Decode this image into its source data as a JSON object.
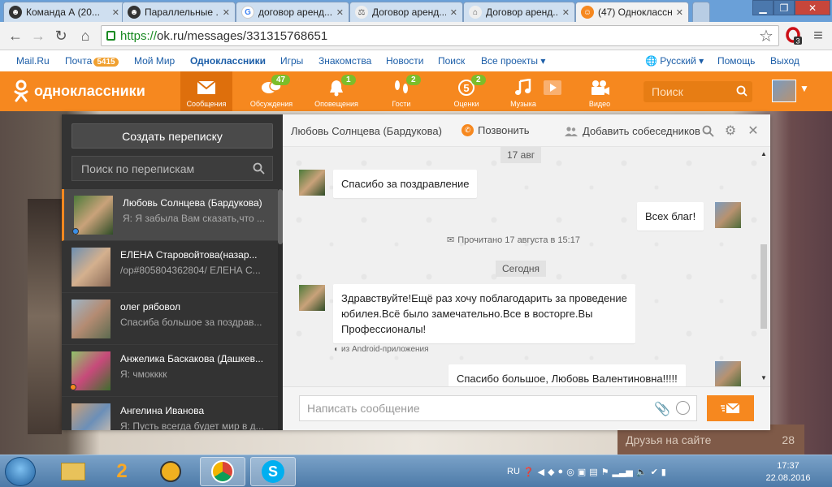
{
  "browser": {
    "tabs": [
      {
        "label": "Команда А (20...",
        "favicon": "face",
        "active": false
      },
      {
        "label": "Параллельные ...",
        "favicon": "face",
        "active": false
      },
      {
        "label": "договор аренд...",
        "favicon": "G",
        "active": false
      },
      {
        "label": "Договор аренд...",
        "favicon": "scales",
        "active": false
      },
      {
        "label": "Договор аренд...",
        "favicon": "house",
        "active": false
      },
      {
        "label": "(47) Одноклассн...",
        "favicon": "ok",
        "active": true
      }
    ],
    "url_scheme": "https://",
    "url_rest": "ok.ru/messages/331315768651",
    "opera_badge": "3"
  },
  "portal": {
    "links": [
      "Mail.Ru",
      "Почта",
      "Мой Мир",
      "Одноклассники",
      "Игры",
      "Знакомства",
      "Новости",
      "Поиск",
      "Все проекты ▾"
    ],
    "mail_count": "5415",
    "language": "Русский ▾",
    "help": "Помощь",
    "logout": "Выход"
  },
  "ok_header": {
    "logo_text": "одноклассники",
    "nav": [
      {
        "label": "Сообщения",
        "badge": "",
        "icon": "envelope-icon"
      },
      {
        "label": "Обсуждения",
        "badge": "47",
        "icon": "chat-bubbles-icon"
      },
      {
        "label": "Оповещения",
        "badge": "1",
        "icon": "bell-icon"
      },
      {
        "label": "Гости",
        "badge": "2",
        "icon": "footprints-icon"
      },
      {
        "label": "Оценки",
        "badge": "2",
        "icon": "rating-five-icon"
      },
      {
        "label": "Музыка",
        "badge": "",
        "icon": "music-note-icon"
      },
      {
        "label": "Видео",
        "badge": "",
        "icon": "video-camera-icon"
      }
    ],
    "search_placeholder": "Поиск"
  },
  "messenger": {
    "create_label": "Создать переписку",
    "search_placeholder": "Поиск по перепискам",
    "conversations": [
      {
        "name": "Любовь Солнцева (Бардукова)",
        "preview": "Я: Я забыла Вам сказать,что ...",
        "active": true,
        "status": "#3a8ee6"
      },
      {
        "name": "ЕЛЕНА Старовойтова(назар...",
        "preview": "/op#805804362804/ ЕЛЕНА С...",
        "active": false,
        "status": ""
      },
      {
        "name": "олег рябовол",
        "preview": "Спасиба большое за поздрав...",
        "active": false,
        "status": ""
      },
      {
        "name": "Анжелика Баскакова (Дашкев...",
        "preview": "Я: чмокккк",
        "active": false,
        "status": "#f6881f"
      },
      {
        "name": "Ангелина Иванова",
        "preview": "Я: Пусть всегда будет мир в д...",
        "active": false,
        "status": "#f6881f"
      }
    ],
    "chat": {
      "name": "Любовь Солнцева (Бардукова)",
      "call_label": "Позвонить",
      "add_label": "Добавить собеседников",
      "date1": "17 авг",
      "msg1": "Спасибо за поздравление",
      "msg2": "Всех благ!",
      "read_text": "Прочитано 17 августа в 15:17",
      "date2": "Сегодня",
      "msg3": "Здравствуйте!Ещё раз хочу поблагодарить за проведение юбилея.Всё было замечательно.Все в восторге.Вы  Профессионалы!",
      "msg3_source": "из Android-приложения",
      "msg4": "Спасибо большое, Любовь Валентиновна!!!!!",
      "input_placeholder": "Написать сообщение"
    }
  },
  "background": {
    "friends_label": "Друзья на сайте",
    "friends_count": "28"
  },
  "taskbar": {
    "lang": "RU",
    "time": "17:37",
    "date": "22.08.2016"
  },
  "colors": {
    "ok_orange": "#f6881f",
    "badge_green": "#7cbd2a",
    "link_blue": "#1c5ea8"
  }
}
